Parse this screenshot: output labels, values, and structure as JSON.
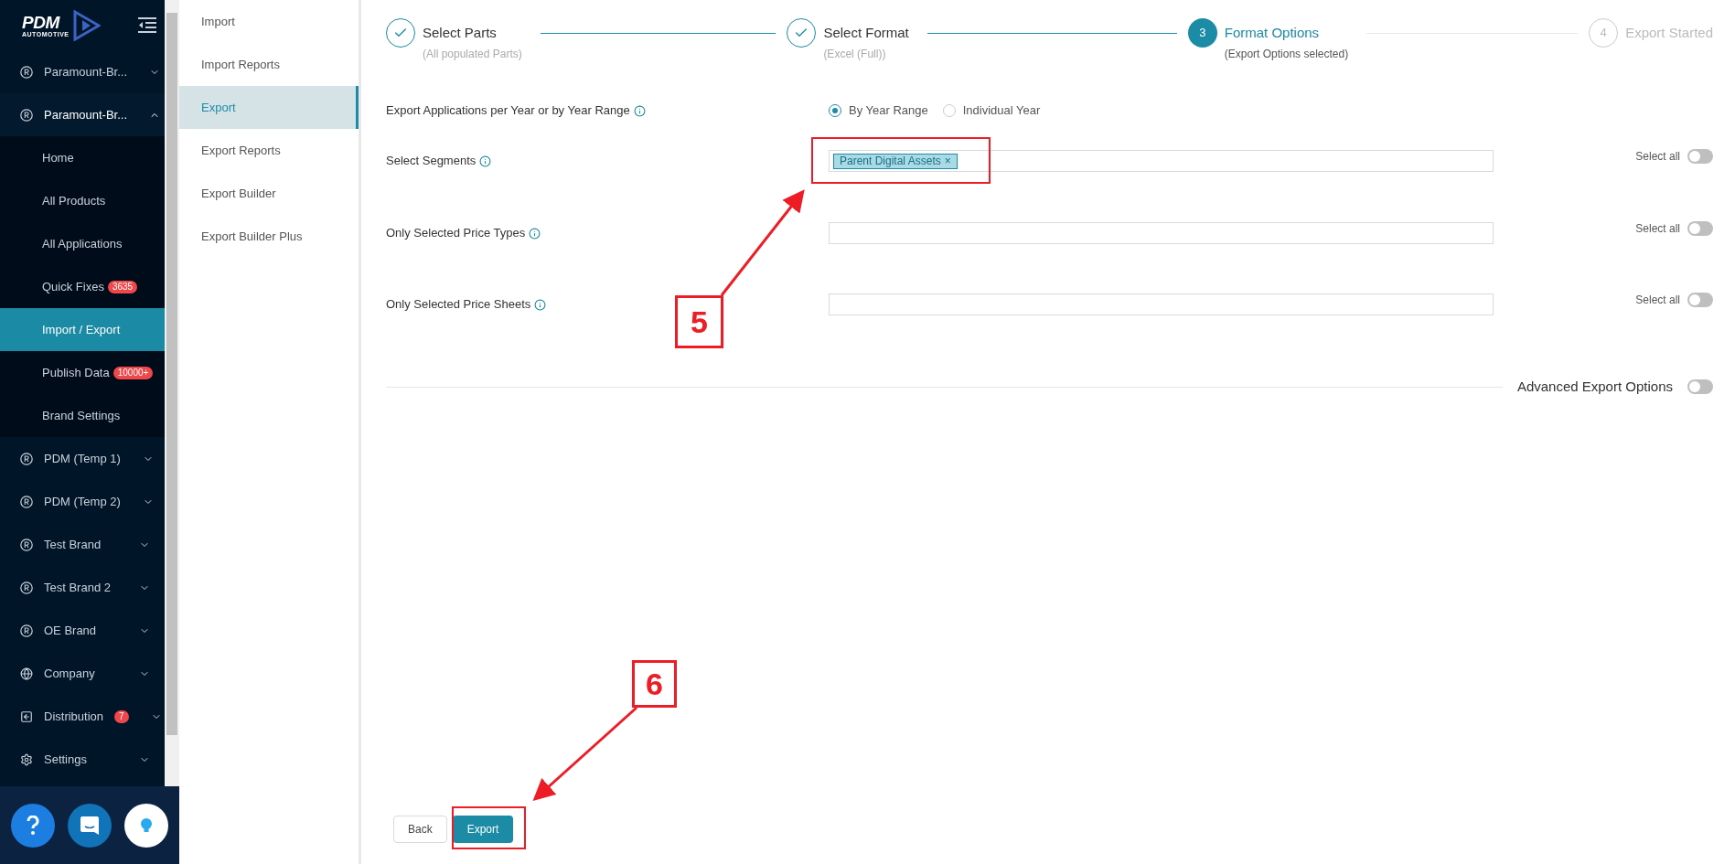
{
  "sidebar": {
    "logo": {
      "title": "PDM",
      "subtitle": "AUTOMOTIVE"
    },
    "items": [
      {
        "label": "Paramount-Br...",
        "kind": "brand",
        "expanded": false
      },
      {
        "label": "Paramount-Br...",
        "kind": "brand",
        "expanded": true,
        "children": [
          {
            "label": "Home",
            "selected": false
          },
          {
            "label": "All Products",
            "selected": false
          },
          {
            "label": "All Applications",
            "selected": false
          },
          {
            "label": "Quick Fixes",
            "selected": false,
            "badge": "3635"
          },
          {
            "label": "Import / Export",
            "selected": true
          },
          {
            "label": "Publish Data",
            "selected": false,
            "badge": "10000+"
          },
          {
            "label": "Brand Settings",
            "selected": false
          }
        ]
      },
      {
        "label": "PDM (Temp 1)",
        "kind": "brand",
        "expanded": false
      },
      {
        "label": "PDM (Temp 2)",
        "kind": "brand",
        "expanded": false
      },
      {
        "label": "Test Brand",
        "kind": "brand",
        "expanded": false
      },
      {
        "label": "Test Brand 2",
        "kind": "brand",
        "expanded": false
      },
      {
        "label": "OE Brand",
        "kind": "brand",
        "expanded": false
      },
      {
        "label": "Company",
        "kind": "globe",
        "expanded": false
      },
      {
        "label": "Distribution",
        "kind": "box",
        "expanded": false,
        "badge": "7"
      },
      {
        "label": "Settings",
        "kind": "gear",
        "expanded": false
      }
    ]
  },
  "submenu": [
    {
      "label": "Import",
      "selected": false
    },
    {
      "label": "Import Reports",
      "selected": false
    },
    {
      "label": "Export",
      "selected": true
    },
    {
      "label": "Export Reports",
      "selected": false
    },
    {
      "label": "Export Builder",
      "selected": false
    },
    {
      "label": "Export Builder Plus",
      "selected": false
    }
  ],
  "steps": [
    {
      "title": "Select Parts",
      "subtitle": "(All populated Parts)",
      "kind": "done"
    },
    {
      "title": "Select Format",
      "subtitle": "(Excel (Full))",
      "kind": "done"
    },
    {
      "number": "3",
      "title": "Format Options",
      "subtitle": "(Export Options selected)",
      "kind": "active"
    },
    {
      "number": "4",
      "title": "Export Started",
      "kind": "pending"
    }
  ],
  "form": [
    {
      "kind": "radio",
      "label": "Export Applications per Year or by Year Range",
      "options": [
        {
          "label": "By Year Range",
          "selected": true
        },
        {
          "label": "Individual Year",
          "selected": false
        }
      ]
    },
    {
      "kind": "multiselect",
      "label": "Select Segments",
      "tags": [
        {
          "label": "Parent Digital Assets",
          "remove": "×"
        }
      ],
      "select_all": {
        "label": "Select all",
        "on": false
      }
    },
    {
      "kind": "multiselect",
      "label": "Only Selected Price Types",
      "select_all": {
        "label": "Select all",
        "on": false
      }
    },
    {
      "kind": "multiselect",
      "label": "Only Selected Price Sheets",
      "select_all": {
        "label": "Select all",
        "on": false
      }
    }
  ],
  "advanced": {
    "label": "Advanced Export Options",
    "on": false
  },
  "buttons": [
    {
      "label": "Back",
      "kind": "secondary"
    },
    {
      "label": "Export",
      "kind": "primary"
    }
  ],
  "annotations": [
    {
      "number": "5"
    },
    {
      "number": "6"
    }
  ]
}
